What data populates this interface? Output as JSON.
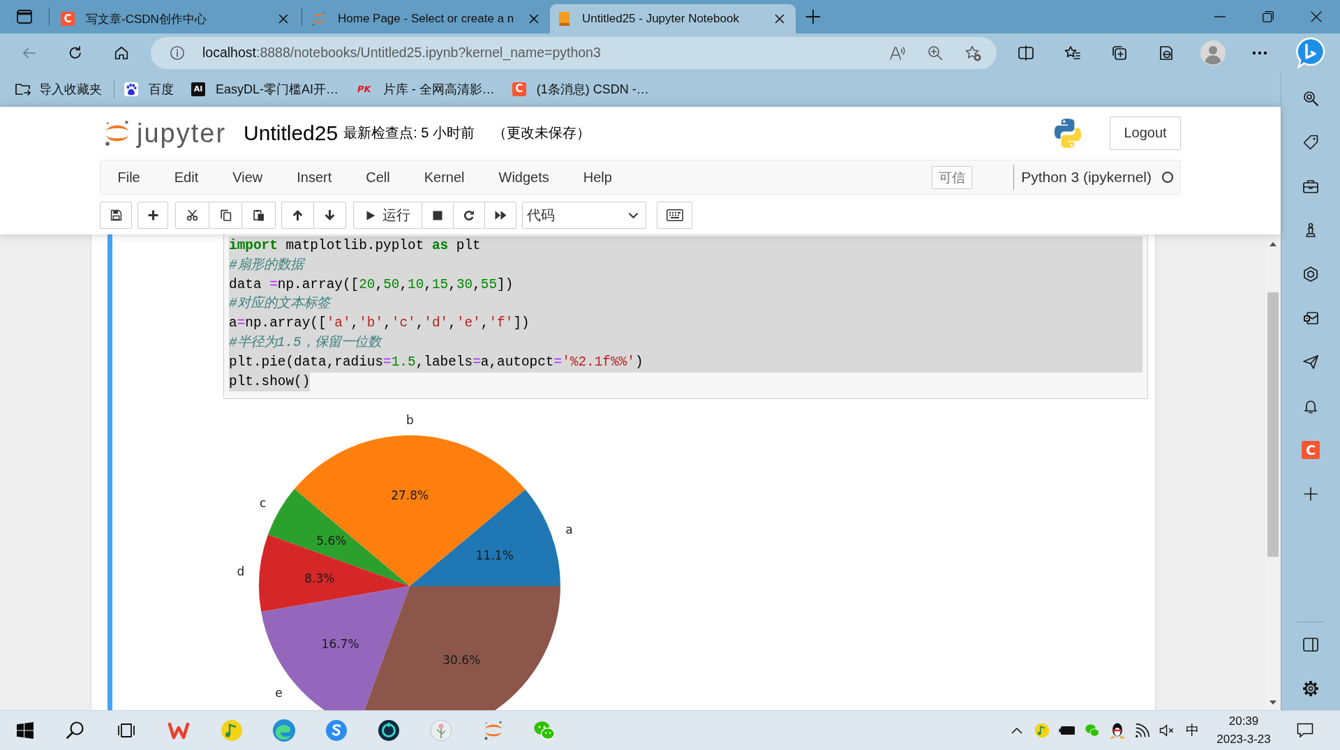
{
  "browser": {
    "tabs": [
      {
        "kind": "csdn",
        "badge": "C",
        "title": "写文章-CSDN创作中心",
        "selected": false
      },
      {
        "kind": "jupyter",
        "title": "Home Page - Select or create a n",
        "selected": false
      },
      {
        "kind": "notebook",
        "title": "Untitled25 - Jupyter Notebook",
        "selected": true
      }
    ],
    "address": {
      "host": "localhost",
      "rest": ":8888/notebooks/Untitled25.ipynb?kernel_name=python3"
    },
    "bookmarks": [
      {
        "kind": "import",
        "label": "导入收藏夹"
      },
      {
        "kind": "baidu",
        "label": "百度"
      },
      {
        "kind": "ai",
        "badge": "AI",
        "label": "EasyDL-零门槛AI开…"
      },
      {
        "kind": "pk",
        "badge": "PK",
        "label": "片库 - 全网高清影…"
      },
      {
        "kind": "csdn",
        "badge": "C",
        "label": "(1条消息) CSDN -…"
      }
    ],
    "sidebar": {
      "app_badge": "C"
    }
  },
  "notebook": {
    "brand": "jupyter",
    "name": "Untitled25",
    "checkpoint": "最新检查点: 5 小时前",
    "save_status": "（更改未保存）",
    "logout": "Logout",
    "menu": [
      "File",
      "Edit",
      "View",
      "Insert",
      "Cell",
      "Kernel",
      "Widgets",
      "Help"
    ],
    "trusted": "可信",
    "kernel": {
      "name": "Python 3 (ipykernel)",
      "busy": false
    },
    "toolbar": {
      "run": "运行",
      "cell_type": "代码"
    },
    "cell": {
      "selected": true,
      "lines": [
        {
          "selected": true,
          "tokens": [
            {
              "kind": "keyword",
              "text": "import"
            },
            {
              "kind": "plain",
              "text": " matplotlib.pyplot "
            },
            {
              "kind": "keyword",
              "text": "as"
            },
            {
              "kind": "plain",
              "text": " plt"
            }
          ]
        },
        {
          "selected": true,
          "tokens": [
            {
              "kind": "comment",
              "text": "#扇形的数据"
            }
          ]
        },
        {
          "selected": true,
          "tokens": [
            {
              "kind": "plain",
              "text": "data "
            },
            {
              "kind": "operator",
              "text": "="
            },
            {
              "kind": "plain",
              "text": "np.array(["
            },
            {
              "kind": "number",
              "text": "20"
            },
            {
              "kind": "plain",
              "text": ","
            },
            {
              "kind": "number",
              "text": "50"
            },
            {
              "kind": "plain",
              "text": ","
            },
            {
              "kind": "number",
              "text": "10"
            },
            {
              "kind": "plain",
              "text": ","
            },
            {
              "kind": "number",
              "text": "15"
            },
            {
              "kind": "plain",
              "text": ","
            },
            {
              "kind": "number",
              "text": "30"
            },
            {
              "kind": "plain",
              "text": ","
            },
            {
              "kind": "number",
              "text": "55"
            },
            {
              "kind": "plain",
              "text": "])"
            }
          ]
        },
        {
          "selected": true,
          "tokens": [
            {
              "kind": "comment",
              "text": "#对应的文本标签"
            }
          ]
        },
        {
          "selected": true,
          "tokens": [
            {
              "kind": "plain",
              "text": "a"
            },
            {
              "kind": "operator",
              "text": "="
            },
            {
              "kind": "plain",
              "text": "np.array(["
            },
            {
              "kind": "string",
              "text": "'a'"
            },
            {
              "kind": "plain",
              "text": ","
            },
            {
              "kind": "string",
              "text": "'b'"
            },
            {
              "kind": "plain",
              "text": ","
            },
            {
              "kind": "string",
              "text": "'c'"
            },
            {
              "kind": "plain",
              "text": ","
            },
            {
              "kind": "string",
              "text": "'d'"
            },
            {
              "kind": "plain",
              "text": ","
            },
            {
              "kind": "string",
              "text": "'e'"
            },
            {
              "kind": "plain",
              "text": ","
            },
            {
              "kind": "string",
              "text": "'f'"
            },
            {
              "kind": "plain",
              "text": "])"
            }
          ]
        },
        {
          "selected": true,
          "tokens": [
            {
              "kind": "comment",
              "text": "#半径为1.5，保留一位数"
            }
          ]
        },
        {
          "selected": true,
          "tokens": [
            {
              "kind": "plain",
              "text": "plt.pie(data,radius"
            },
            {
              "kind": "operator",
              "text": "="
            },
            {
              "kind": "number",
              "text": "1.5"
            },
            {
              "kind": "plain",
              "text": ",labels"
            },
            {
              "kind": "operator",
              "text": "="
            },
            {
              "kind": "plain",
              "text": "a,autopct"
            },
            {
              "kind": "operator",
              "text": "="
            },
            {
              "kind": "string",
              "text": "'%2.1f%%'"
            },
            {
              "kind": "plain",
              "text": ")"
            }
          ]
        },
        {
          "selected": true,
          "tokens": [
            {
              "kind": "plain",
              "text": "plt.show()"
            }
          ]
        }
      ],
      "output": {
        "chart_data": [
          {
            "type": "pie",
            "categories": [
              "a",
              "b",
              "c",
              "d",
              "e",
              null
            ],
            "values": [
              11.1,
              27.8,
              5.6,
              8.3,
              16.7,
              30.6
            ],
            "colors": [
              "#1f77b4",
              "#ff7f0e",
              "#2ca02c",
              "#d62728",
              "#9467bd",
              "#8c564b"
            ],
            "value_labels": [
              "11.1%",
              "27.8%",
              "5.6%",
              "8.3%",
              "16.7%",
              "30.6%"
            ]
          }
        ]
      }
    }
  },
  "taskbar": {
    "input_method": "中",
    "time": "20:39",
    "date": "2023-3-23"
  }
}
